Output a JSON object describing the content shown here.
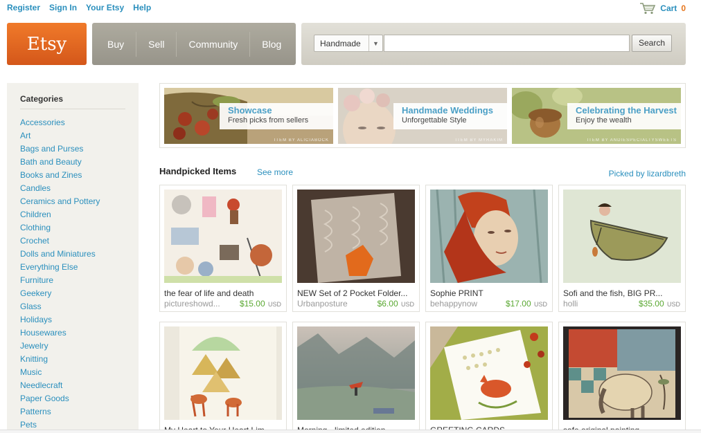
{
  "top_links": [
    "Register",
    "Sign In",
    "Your Etsy",
    "Help"
  ],
  "cart": {
    "label": "Cart",
    "count": "0"
  },
  "logo": "Etsy",
  "nav": [
    "Buy",
    "Sell",
    "Community",
    "Blog"
  ],
  "search": {
    "category": "Handmade",
    "value": "",
    "button": "Search"
  },
  "sidebar": {
    "title": "Categories",
    "items": [
      "Accessories",
      "Art",
      "Bags and Purses",
      "Bath and Beauty",
      "Books and Zines",
      "Candles",
      "Ceramics and Pottery",
      "Children",
      "Clothing",
      "Crochet",
      "Dolls and Miniatures",
      "Everything Else",
      "Furniture",
      "Geekery",
      "Glass",
      "Holidays",
      "Housewares",
      "Jewelry",
      "Knitting",
      "Music",
      "Needlecraft",
      "Paper Goods",
      "Patterns",
      "Pets"
    ]
  },
  "banners": [
    {
      "title": "Showcase",
      "subtitle": "Fresh picks from sellers",
      "credit": "ITEM BY ALICIABOCK"
    },
    {
      "title": "Handmade Weddings",
      "subtitle": "Unforgettable Style",
      "credit": "ITEM BY MYRAKIM"
    },
    {
      "title": "Celebrating the Harvest",
      "subtitle": "Enjoy the wealth",
      "credit": "ITEM BY ANDIESPECIALTYSWEETS"
    }
  ],
  "handpicked": {
    "title": "Handpicked Items",
    "see_more": "See more",
    "picked_by": "Picked by lizardbreth"
  },
  "items": [
    {
      "title": "the fear of life and death",
      "shop": "pictureshowd...",
      "price": "$15.00",
      "currency": "USD"
    },
    {
      "title": "NEW Set of 2 Pocket Folder...",
      "shop": "Urbanposture",
      "price": "$6.00",
      "currency": "USD"
    },
    {
      "title": "Sophie PRINT",
      "shop": "behappynow",
      "price": "$17.00",
      "currency": "USD"
    },
    {
      "title": "Sofi and the fish, BIG PR...",
      "shop": "holli",
      "price": "$35.00",
      "currency": "USD"
    },
    {
      "title": "My Heart to Your Heart Lim...",
      "shop": "",
      "price": "",
      "currency": ""
    },
    {
      "title": "Morning - limited edition",
      "shop": "",
      "price": "",
      "currency": ""
    },
    {
      "title": "GREETING CARDS",
      "shop": "",
      "price": "",
      "currency": ""
    },
    {
      "title": "safe original painting",
      "shop": "",
      "price": "",
      "currency": ""
    }
  ]
}
